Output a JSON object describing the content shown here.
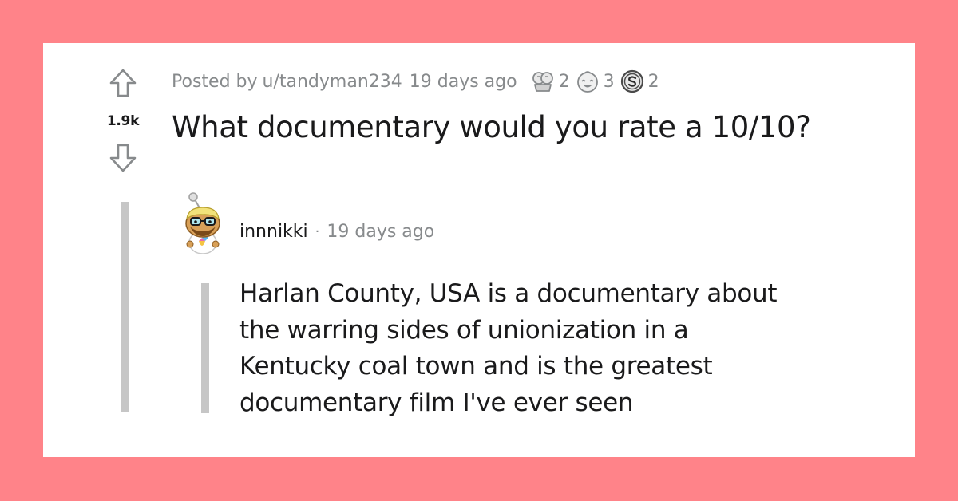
{
  "post": {
    "score": "1.9k",
    "posted_by_prefix": "Posted by",
    "author": "u/tandyman234",
    "time": "19 days ago",
    "title": "What documentary would you rate a 10/10?",
    "awards": [
      {
        "icon": "bravo-award-icon",
        "count": "2"
      },
      {
        "icon": "wholesome-award-icon",
        "count": "3"
      },
      {
        "icon": "silver-coin-award-icon",
        "count": "2"
      }
    ]
  },
  "comment": {
    "username": "innnikki",
    "separator": "·",
    "time": "19 days ago",
    "avatar_icon": "snoo-avatar-icon",
    "lines": [
      "Harlan County, USA is a documentary about",
      "the warring sides of unionization in a",
      "Kentucky coal town and is the greatest",
      "documentary film I've ever seen"
    ]
  },
  "colors": {
    "page_background": "#ff8389",
    "card_background": "#ffffff",
    "text_primary": "#1a1a1b",
    "text_meta": "#878a8c",
    "thread_line": "#c6c6c6"
  }
}
